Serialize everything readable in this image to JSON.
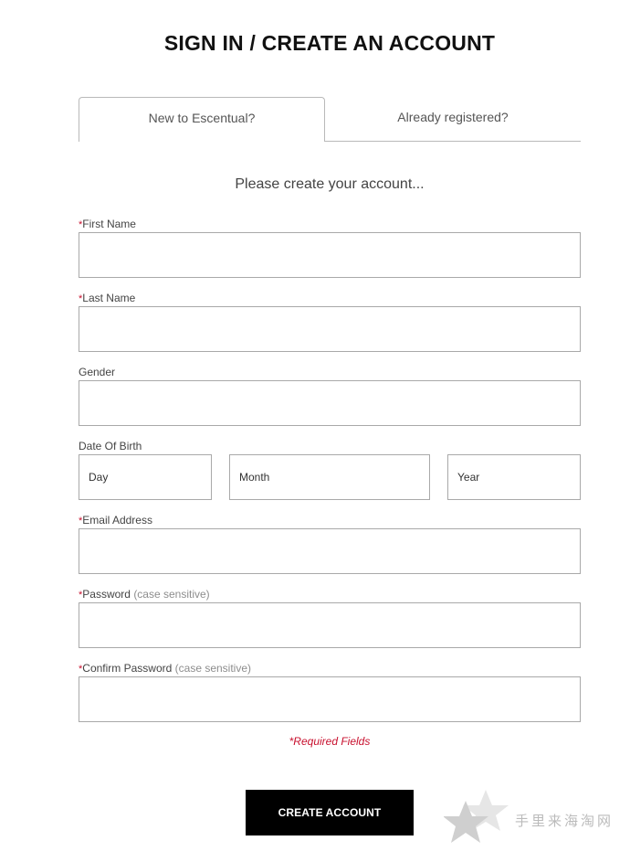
{
  "page": {
    "title": "SIGN IN / CREATE AN ACCOUNT"
  },
  "tabs": [
    {
      "label": "New to Escentual?",
      "active": true
    },
    {
      "label": "Already registered?",
      "active": false
    }
  ],
  "form": {
    "subtitle": "Please create your account...",
    "required_marker": "*",
    "fields": {
      "first_name": {
        "label": "First Name",
        "required": true,
        "value": ""
      },
      "last_name": {
        "label": "Last Name",
        "required": true,
        "value": ""
      },
      "gender": {
        "label": "Gender",
        "required": false,
        "value": ""
      },
      "dob": {
        "label": "Date Of Birth",
        "day": "Day",
        "month": "Month",
        "year": "Year"
      },
      "email": {
        "label": "Email Address",
        "required": true,
        "value": ""
      },
      "password": {
        "label": "Password",
        "hint": "(case sensitive)",
        "required": true,
        "value": ""
      },
      "confirm_password": {
        "label": "Confirm Password",
        "hint": "(case sensitive)",
        "required": true,
        "value": ""
      }
    },
    "required_note": "*Required Fields",
    "submit_label": "CREATE ACCOUNT"
  },
  "watermark": {
    "text": "手里来海淘网",
    "icon": "star-icon"
  },
  "colors": {
    "required": "#c8102e",
    "button_bg": "#000000",
    "border": "#a9a9a9"
  }
}
